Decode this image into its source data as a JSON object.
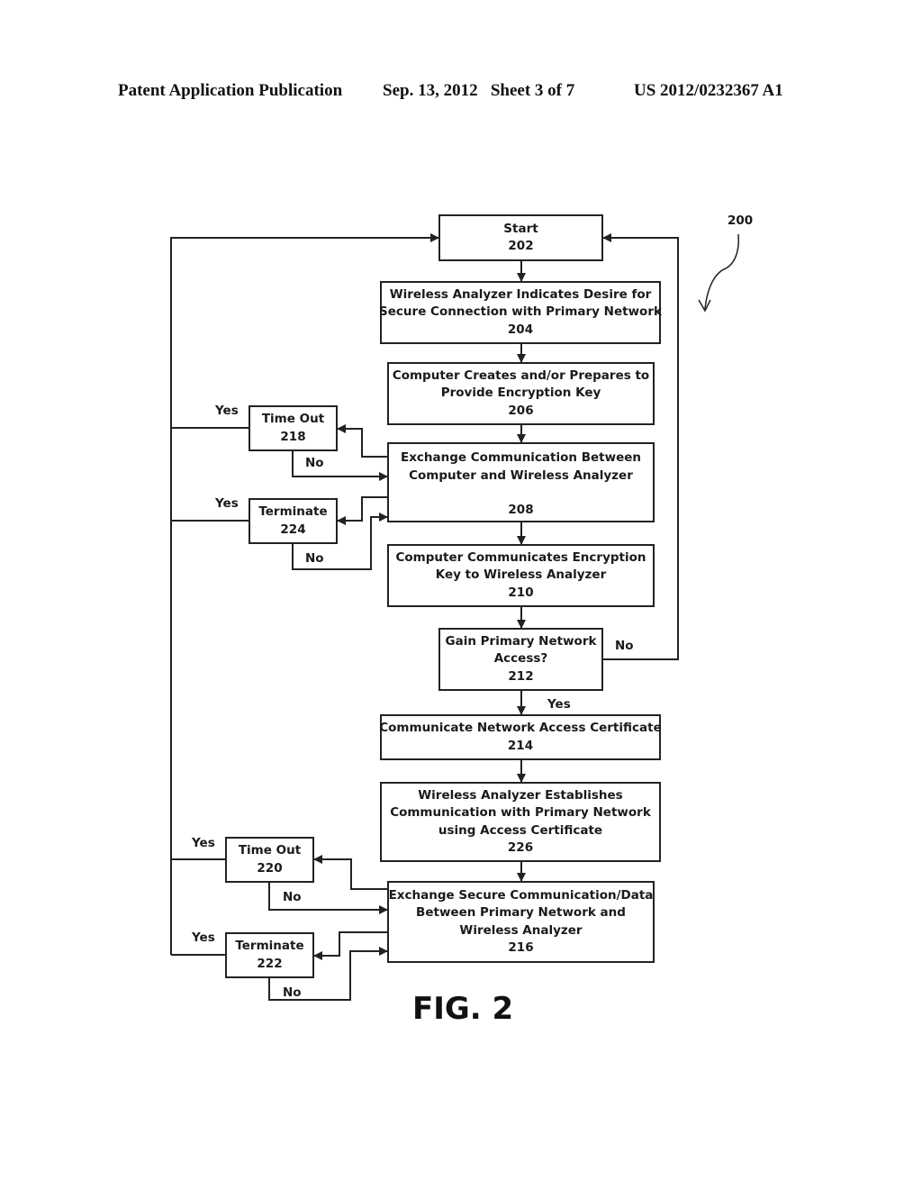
{
  "header": {
    "publication": "Patent Application Publication",
    "date_sheet": "Sep. 13, 2012   Sheet 3 of 7",
    "patent_number": "US 2012/0232367 A1"
  },
  "figure": {
    "label": "FIG. 2",
    "reference": "200"
  },
  "nodes": {
    "n202": {
      "lines": [
        "Start"
      ],
      "num": "202"
    },
    "n204": {
      "lines": [
        "Wireless Analyzer Indicates Desire for",
        "Secure Connection with Primary Network"
      ],
      "num": "204"
    },
    "n206": {
      "lines": [
        "Computer Creates and/or Prepares to",
        "Provide Encryption Key"
      ],
      "num": "206"
    },
    "n208": {
      "lines": [
        "Exchange Communication Between",
        "Computer and Wireless Analyzer"
      ],
      "num": "208"
    },
    "n210": {
      "lines": [
        "Computer Communicates Encryption",
        "Key to Wireless Analyzer"
      ],
      "num": "210"
    },
    "n212": {
      "lines": [
        "Gain Primary Network",
        "Access?"
      ],
      "num": "212"
    },
    "n214": {
      "lines": [
        "Communicate Network Access Certificate"
      ],
      "num": "214"
    },
    "n226": {
      "lines": [
        "Wireless Analyzer Establishes",
        "Communication with Primary  Network",
        "using Access Certificate"
      ],
      "num": "226"
    },
    "n216": {
      "lines": [
        "Exchange Secure Communication/Data",
        "Between Primary Network and",
        "Wireless Analyzer"
      ],
      "num": "216"
    },
    "n218": {
      "lines": [
        "Time Out"
      ],
      "num": "218"
    },
    "n224": {
      "lines": [
        "Terminate"
      ],
      "num": "224"
    },
    "n220": {
      "lines": [
        "Time Out"
      ],
      "num": "220"
    },
    "n222": {
      "lines": [
        "Terminate"
      ],
      "num": "222"
    }
  },
  "edge_labels": {
    "yes_218": "Yes",
    "no_218": "No",
    "yes_224": "Yes",
    "no_224": "No",
    "no_212": "No",
    "yes_212": "Yes",
    "yes_220": "Yes",
    "no_220": "No",
    "yes_222": "Yes",
    "no_222": "No"
  }
}
